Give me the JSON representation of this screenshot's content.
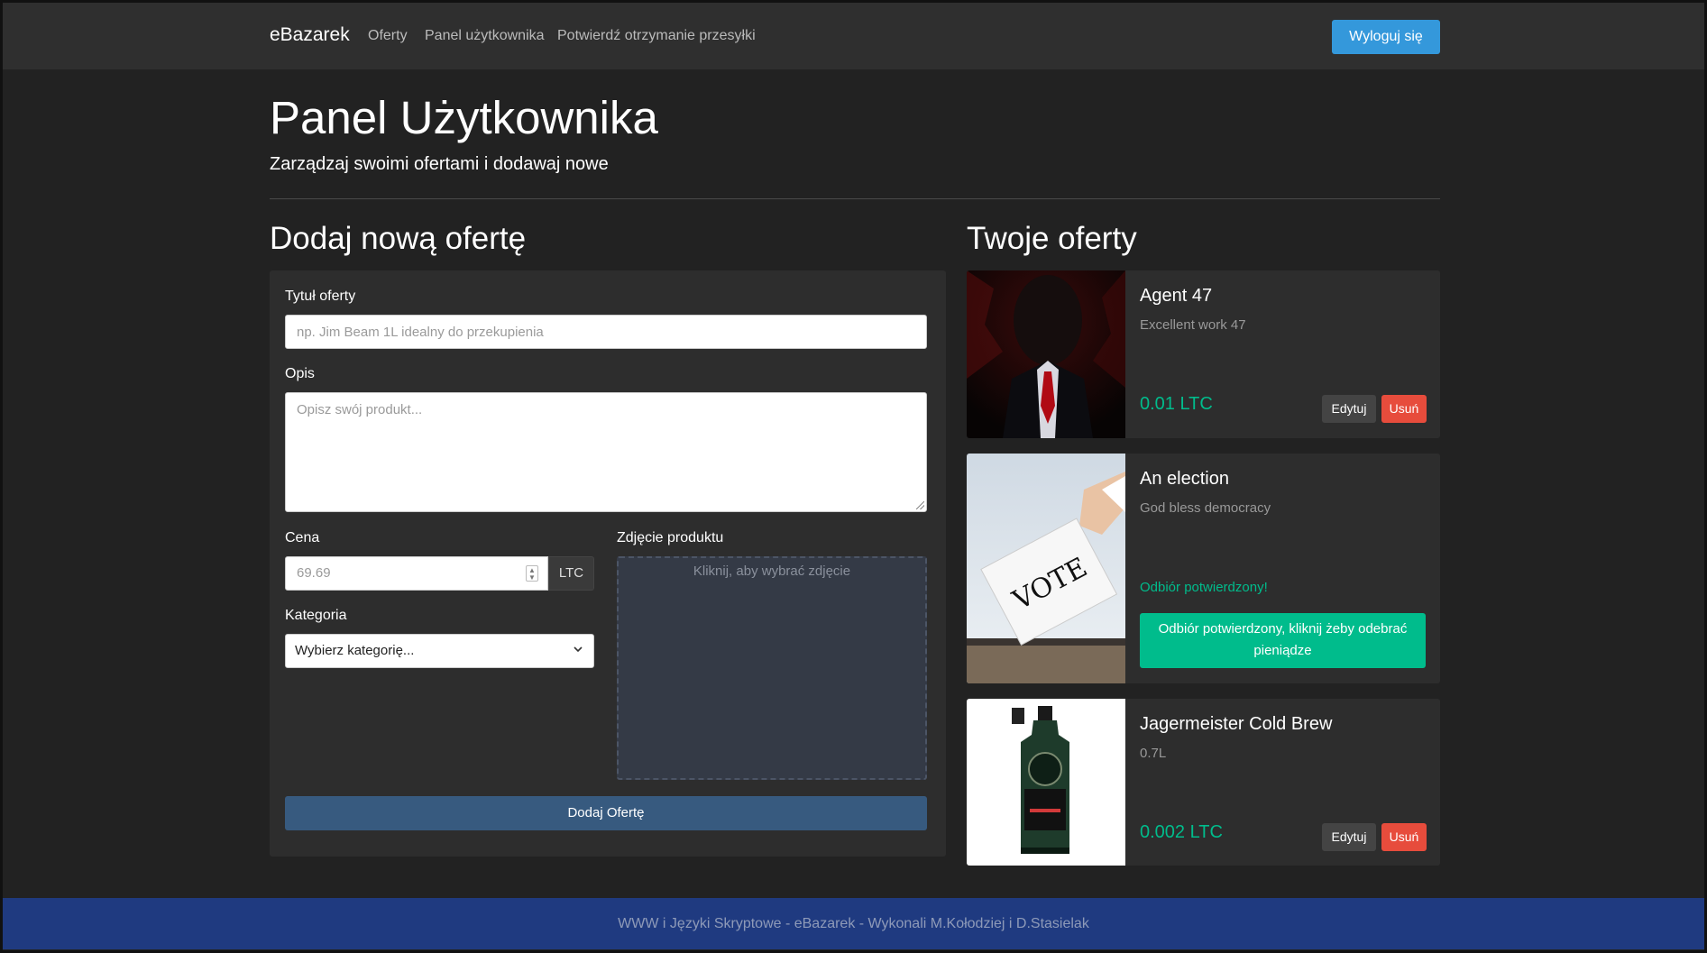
{
  "nav": {
    "brand": "eBazarek",
    "links": [
      "Oferty",
      "Panel użytkownika",
      "Potwierdź otrzymanie przesyłki"
    ],
    "logout_label": "Wyloguj się"
  },
  "header": {
    "title": "Panel Użytkownika",
    "subtitle": "Zarządzaj swoimi ofertami i dodawaj nowe"
  },
  "form": {
    "heading": "Dodaj nową ofertę",
    "title_label": "Tytuł oferty",
    "title_placeholder": "np. Jim Beam 1L idealny do przekupienia",
    "desc_label": "Opis",
    "desc_placeholder": "Opisz swój produkt...",
    "price_label": "Cena",
    "price_placeholder": "69.69",
    "currency": "LTC",
    "category_label": "Kategoria",
    "category_selected": "Wybierz kategorię...",
    "photo_label": "Zdjęcie produktu",
    "photo_hint": "Kliknij, aby wybrać zdjęcie",
    "submit_label": "Dodaj Ofertę"
  },
  "offers": {
    "heading": "Twoje oferty",
    "edit_label": "Edytuj",
    "delete_label": "Usuń",
    "items": [
      {
        "title": "Agent 47",
        "desc": "Excellent work 47",
        "price": "0.01 LTC"
      },
      {
        "title": "An election",
        "desc": "God bless democracy",
        "status": "Odbiór potwierdzony!",
        "action": "Odbiór potwierdzony, kliknij żeby odebrać pieniądze",
        "image_text": "VOTE"
      },
      {
        "title": "Jagermeister Cold Brew",
        "desc": "0.7L",
        "price": "0.002 LTC"
      }
    ]
  },
  "footer": {
    "text": "WWW i Języki Skryptowe - eBazarek - Wykonali M.Kołodziej i D.Stasielak"
  },
  "colors": {
    "accent_blue": "#3498db",
    "success": "#00bc8c",
    "danger": "#e74c3c",
    "primary": "#375a7f"
  }
}
